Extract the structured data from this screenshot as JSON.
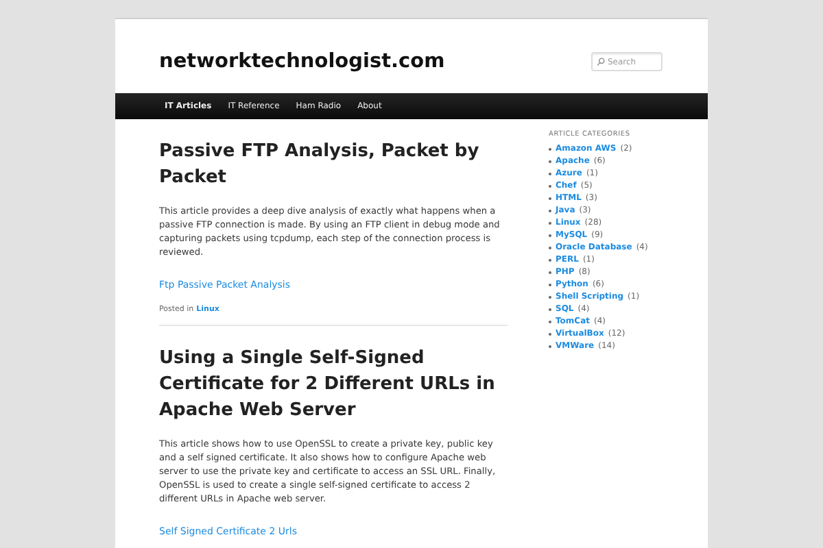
{
  "site": {
    "title": "networktechnologist.com",
    "search": {
      "placeholder": "Search"
    }
  },
  "nav": [
    {
      "label": "IT Articles",
      "selected": true
    },
    {
      "label": "IT Reference",
      "selected": false
    },
    {
      "label": "Ham Radio",
      "selected": false
    },
    {
      "label": "About",
      "selected": false
    }
  ],
  "posts": [
    {
      "title": "Passive FTP Analysis, Packet by Packet",
      "excerpt": "This article provides a deep dive analysis of exactly what happens when a passive FTP connection is made.  By using an FTP client in debug mode and capturing packets using tcpdump, each step of the connection process is reviewed.",
      "link": "Ftp Passive Packet Analysis",
      "posted_in": "Posted in",
      "category": "Linux"
    },
    {
      "title": "Using a Single Self-Signed Certificate for 2 Different URLs in Apache Web Server",
      "excerpt": "This article shows how to use OpenSSL to create a private key, public key and a self signed certificate.  It also shows how to configure Apache web server to use the private key and certificate to access an SSL URL.  Finally, OpenSSL is used to create a single self-signed certificate to access 2 different URLs in Apache web server.",
      "link": "Self Signed Certificate 2 Urls"
    }
  ],
  "sidebar": {
    "heading": "ARTICLE CATEGORIES",
    "categories": [
      {
        "name": "Amazon AWS",
        "count": "(2)"
      },
      {
        "name": "Apache",
        "count": "(6)"
      },
      {
        "name": "Azure",
        "count": "(1)"
      },
      {
        "name": "Chef",
        "count": "(5)"
      },
      {
        "name": "HTML",
        "count": "(3)"
      },
      {
        "name": "Java",
        "count": "(3)"
      },
      {
        "name": "Linux",
        "count": "(28)"
      },
      {
        "name": "MySQL",
        "count": "(9)"
      },
      {
        "name": "Oracle Database",
        "count": "(4)"
      },
      {
        "name": "PERL",
        "count": "(1)"
      },
      {
        "name": "PHP",
        "count": "(8)"
      },
      {
        "name": "Python",
        "count": "(6)"
      },
      {
        "name": "Shell Scripting",
        "count": "(1)"
      },
      {
        "name": "SQL",
        "count": "(4)"
      },
      {
        "name": "TomCat",
        "count": "(4)"
      },
      {
        "name": "VirtualBox",
        "count": "(12)"
      },
      {
        "name": "VMWare",
        "count": "(14)"
      }
    ]
  }
}
